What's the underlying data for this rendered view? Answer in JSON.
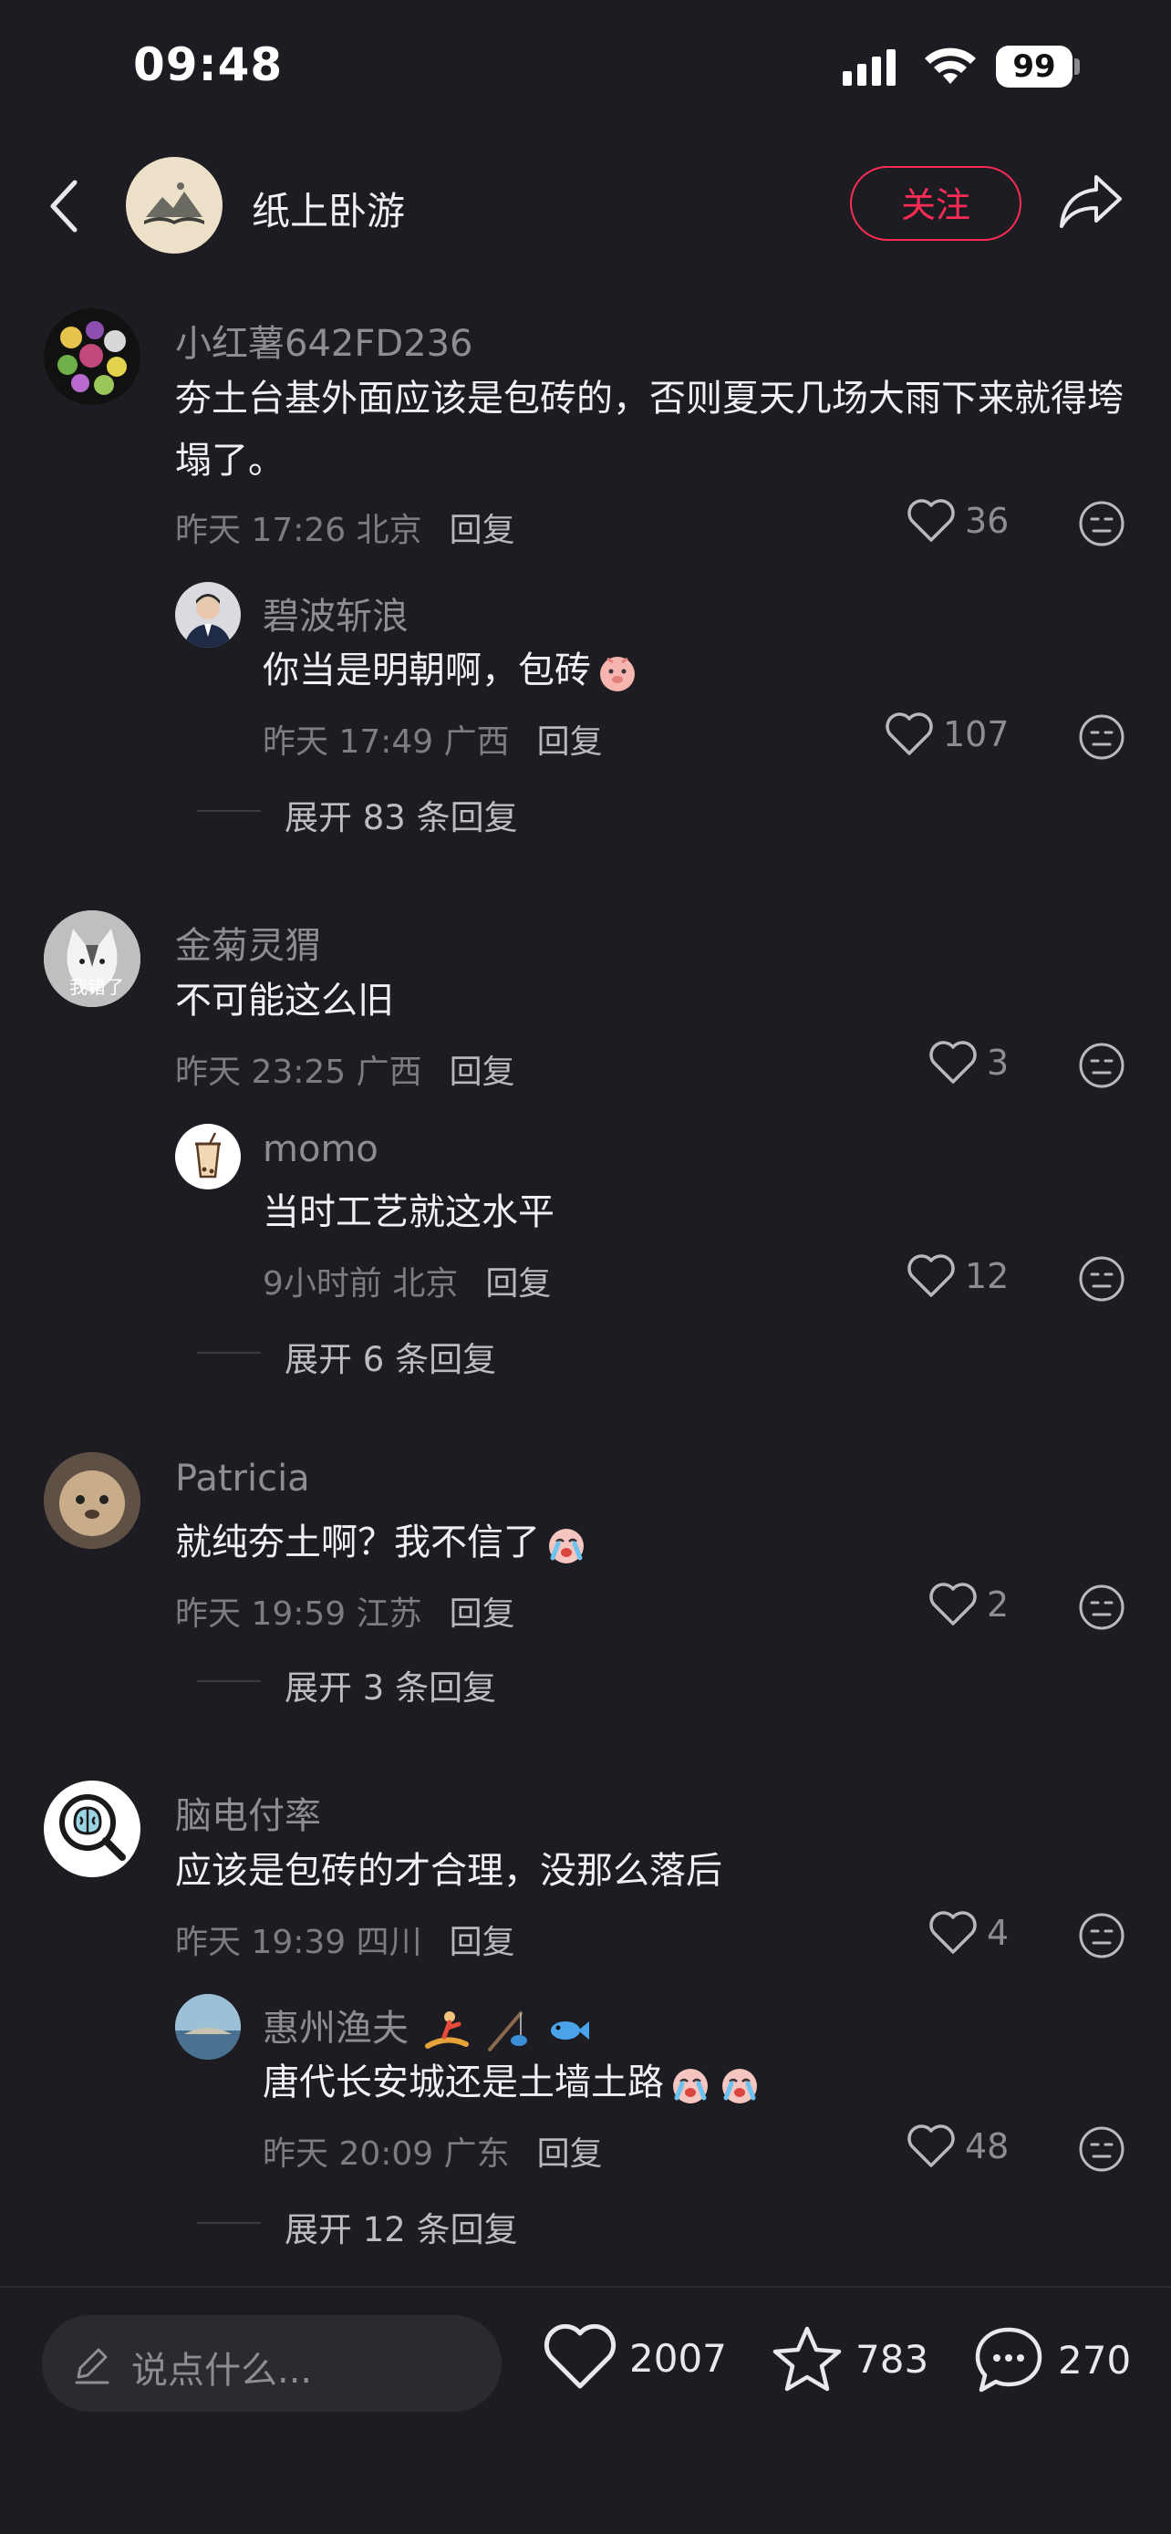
{
  "status_bar": {
    "time": "09:48",
    "battery": "99"
  },
  "header": {
    "account_name": "纸上卧游",
    "follow_label": "关注"
  },
  "comments": [
    {
      "user": "小红薯642FD236",
      "text": "夯土台基外面应该是包砖的，否则夏天几场大雨下来就得垮塌了。",
      "time": "昨天 17:26 北京",
      "reply_label": "回复",
      "likes": "36",
      "replies": [
        {
          "user": "碧波斩浪",
          "text": "你当是明朝啊，包砖",
          "time": "昨天 17:49 广西",
          "reply_label": "回复",
          "likes": "107"
        }
      ],
      "expand": "展开 83 条回复"
    },
    {
      "user": "金菊灵猬",
      "avatar_caption": "我错了",
      "text": "不可能这么旧",
      "time": "昨天 23:25 广西",
      "reply_label": "回复",
      "likes": "3",
      "replies": [
        {
          "user": "momo",
          "text": "当时工艺就这水平",
          "time": "9小时前 北京",
          "reply_label": "回复",
          "likes": "12"
        }
      ],
      "expand": "展开 6 条回复"
    },
    {
      "user": "Patricia",
      "text": "就纯夯土啊？我不信了",
      "time": "昨天 19:59 江苏",
      "reply_label": "回复",
      "likes": "2",
      "replies": [],
      "expand": "展开 3 条回复"
    },
    {
      "user": "脑电付率",
      "text": "应该是包砖的才合理，没那么落后",
      "time": "昨天 19:39 四川",
      "reply_label": "回复",
      "likes": "4",
      "replies": [
        {
          "user": "惠州渔夫",
          "text": "唐代长安城还是土墙土路",
          "time": "昨天 20:09 广东",
          "reply_label": "回复",
          "likes": "48"
        }
      ],
      "expand": "展开 12 条回复"
    }
  ],
  "bottom_bar": {
    "input_placeholder": "说点什么...",
    "likes": "2007",
    "favorites": "783",
    "comments": "270"
  },
  "colors": {
    "accent": "#fe2c55",
    "background": "#1c1c22"
  }
}
